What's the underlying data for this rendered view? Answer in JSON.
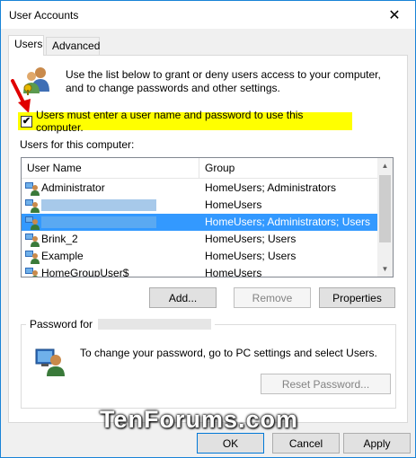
{
  "window": {
    "title": "User Accounts",
    "close_glyph": "✕"
  },
  "tabs": [
    {
      "label": "Users",
      "active": true
    },
    {
      "label": "Advanced",
      "active": false
    }
  ],
  "intro": {
    "text": "Use the list below to grant or deny users access to your computer, and to change passwords and other settings.",
    "icon": "users-icon"
  },
  "must_login": {
    "checked": true,
    "check_glyph": "✔",
    "label": "Users must enter a user name and password to use this computer.",
    "highlight_color": "#ffff00",
    "annotation_arrow_color": "#e00000"
  },
  "users_list": {
    "caption": "Users for this computer:",
    "columns": [
      "User Name",
      "Group"
    ],
    "rows": [
      {
        "name": "Administrator",
        "group": "HomeUsers; Administrators",
        "redacted": false,
        "selected": false
      },
      {
        "name": "",
        "group": "HomeUsers",
        "redacted": true,
        "selected": false
      },
      {
        "name": "",
        "group": "HomeUsers; Administrators; Users",
        "redacted": true,
        "selected": true
      },
      {
        "name": "Brink_2",
        "group": "HomeUsers; Users",
        "redacted": false,
        "selected": false
      },
      {
        "name": "Example",
        "group": "HomeUsers; Users",
        "redacted": false,
        "selected": false
      },
      {
        "name": "HomeGroupUser$",
        "group": "HomeUsers",
        "redacted": false,
        "selected": false
      }
    ],
    "selection_color": "#3399ff"
  },
  "list_buttons": {
    "add": "Add...",
    "remove": "Remove",
    "properties": "Properties"
  },
  "password": {
    "legend": "Password for",
    "text": "To change your password, go to PC settings and select Users.",
    "reset_button": "Reset Password..."
  },
  "watermark": "TenForums.com",
  "footer": {
    "ok": "OK",
    "cancel": "Cancel",
    "apply": "Apply"
  }
}
